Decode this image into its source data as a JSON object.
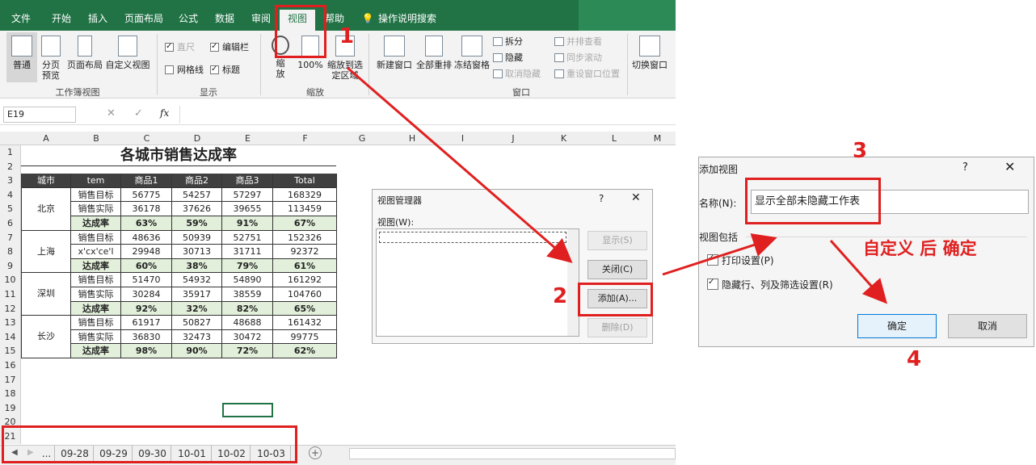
{
  "ribbon_tabs": [
    "文件",
    "开始",
    "插入",
    "页面布局",
    "公式",
    "数据",
    "审阅",
    "视图",
    "帮助",
    "操作说明搜索"
  ],
  "workbook_views": {
    "buttons": [
      "普通",
      "分页预览",
      "页面布局",
      "自定义视图"
    ],
    "group_label": "工作簿视图"
  },
  "show": {
    "items": [
      {
        "label": "直尺",
        "checked": true,
        "disabled": true
      },
      {
        "label": "编辑栏",
        "checked": true,
        "disabled": false
      },
      {
        "label": "网格线",
        "checked": false,
        "disabled": false
      },
      {
        "label": "标题",
        "checked": true,
        "disabled": false
      }
    ],
    "group_label": "显示"
  },
  "zoom": {
    "buttons": [
      "缩放",
      "100%",
      "缩放到选定区域"
    ],
    "group_label": "缩放"
  },
  "window": {
    "buttons": [
      "新建窗口",
      "全部重排",
      "冻结窗格"
    ],
    "small": [
      "拆分",
      "隐藏",
      "取消隐藏"
    ],
    "small2": [
      "并排查看",
      "同步滚动",
      "重设窗口位置"
    ],
    "switch": "切换窗口",
    "group_label": "窗口"
  },
  "formula_bar": {
    "name_box": "E19",
    "fx": "fx"
  },
  "columns": [
    "A",
    "B",
    "C",
    "D",
    "E",
    "F",
    "G",
    "H",
    "I",
    "J",
    "K",
    "L",
    "M"
  ],
  "rows": [
    "1",
    "2",
    "3",
    "4",
    "5",
    "6",
    "7",
    "8",
    "9",
    "10",
    "11",
    "12",
    "13",
    "14",
    "15",
    "16",
    "17",
    "18",
    "19",
    "20",
    "21"
  ],
  "sheet": {
    "title": "各城市销售达成率",
    "headers": [
      "城市",
      "tem",
      "商品1",
      "商品2",
      "商品3",
      "Total"
    ],
    "groups": [
      {
        "city": "北京",
        "rows": [
          [
            "销售目标",
            "56775",
            "54257",
            "57297",
            "168329"
          ],
          [
            "销售实际",
            "36178",
            "37626",
            "39655",
            "113459"
          ],
          [
            "达成率",
            "63%",
            "59%",
            "91%",
            "67%"
          ]
        ]
      },
      {
        "city": "上海",
        "rows": [
          [
            "销售目标",
            "48636",
            "50939",
            "52751",
            "152326"
          ],
          [
            "x'cx'ce'l",
            "29948",
            "30713",
            "31711",
            "92372"
          ],
          [
            "达成率",
            "60%",
            "38%",
            "79%",
            "61%"
          ]
        ]
      },
      {
        "city": "深圳",
        "rows": [
          [
            "销售目标",
            "51470",
            "54932",
            "54890",
            "161292"
          ],
          [
            "销售实际",
            "30284",
            "35917",
            "38559",
            "104760"
          ],
          [
            "达成率",
            "92%",
            "32%",
            "82%",
            "65%"
          ]
        ]
      },
      {
        "city": "长沙",
        "rows": [
          [
            "销售目标",
            "61917",
            "50827",
            "48688",
            "161432"
          ],
          [
            "销售实际",
            "36830",
            "32473",
            "30472",
            "99775"
          ],
          [
            "达成率",
            "98%",
            "90%",
            "72%",
            "62%"
          ]
        ]
      }
    ]
  },
  "sheet_tabs": [
    "...",
    "09-28",
    "09-29",
    "09-30",
    "10-01",
    "10-02",
    "10-03"
  ],
  "view_manager": {
    "title": "视图管理器",
    "help": "?",
    "list_label": "视图(W):",
    "buttons": [
      "显示(S)",
      "关闭(C)",
      "添加(A)...",
      "删除(D)"
    ]
  },
  "add_view": {
    "title": "添加视图",
    "help": "?",
    "name_label": "名称(N):",
    "name_value": "显示全部未隐藏工作表",
    "include_label": "视图包括",
    "options": [
      "打印设置(P)",
      "隐藏行、列及筛选设置(R)"
    ],
    "ok": "确定",
    "cancel": "取消"
  },
  "annotations": {
    "steps": [
      "1",
      "2",
      "3",
      "4"
    ],
    "note": "自定义 后 确定"
  },
  "colors": {
    "excel_green": "#217346",
    "annotation_red": "#e02020",
    "rate_fill": "#e2efda",
    "header_fill": "#404040"
  }
}
